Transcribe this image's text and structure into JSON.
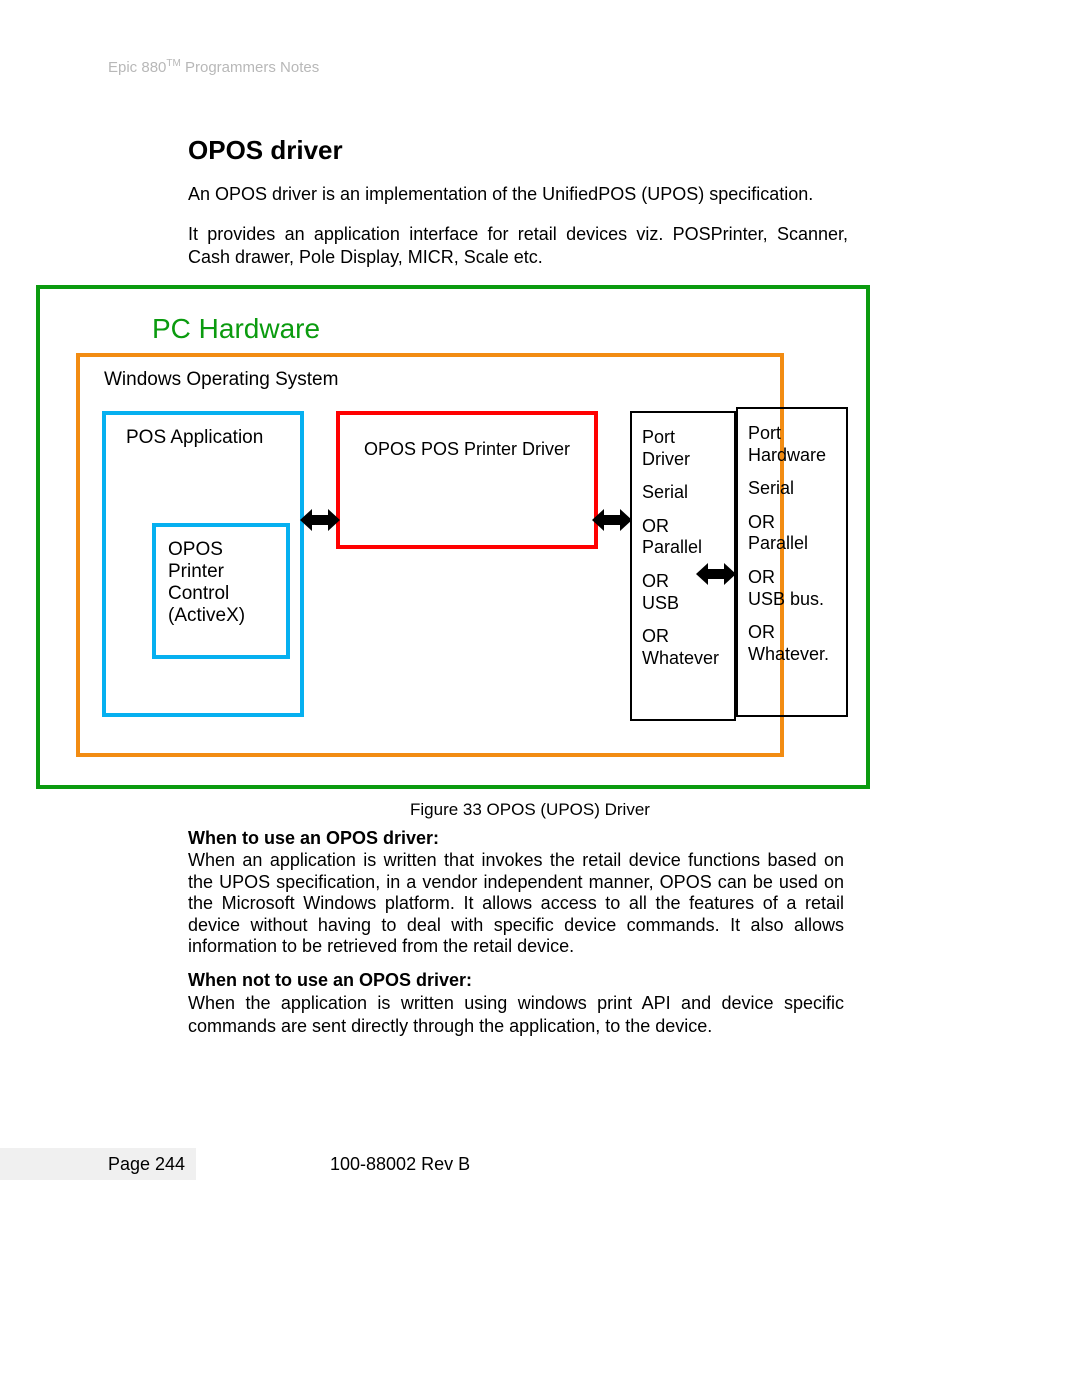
{
  "header": {
    "product": "Epic 880",
    "suffix": " Programmers Notes"
  },
  "title": "OPOS driver",
  "para1": "An OPOS driver is an implementation of the UnifiedPOS (UPOS) specification.",
  "para2": "It provides an application interface for retail devices viz. POSPrinter, Scanner, Cash drawer, Pole Display, MICR, Scale etc.",
  "diagram": {
    "pc_hw": "PC Hardware",
    "win_os": "Windows Operating System",
    "pos_app": "POS Application",
    "opos_ctrl_l1": "OPOS",
    "opos_ctrl_l2": "Printer",
    "opos_ctrl_l3": "Control",
    "opos_ctrl_l4": "(ActiveX)",
    "opos_driver": "OPOS POS Printer Driver",
    "pd_l1": "Port",
    "pd_l2": "Driver",
    "pd_l3": "Serial",
    "pd_l4": "OR",
    "pd_l5": "Parallel",
    "pd_l6": "OR",
    "pd_l7": "USB",
    "pd_l8": "OR",
    "pd_l9": "Whatever",
    "ph_l1": "Port",
    "ph_l2": "Hardware",
    "ph_l3": "Serial",
    "ph_l4": "OR",
    "ph_l5": "Parallel",
    "ph_l6": "OR",
    "ph_l7": "USB bus.",
    "ph_l8": "OR",
    "ph_l9": "Whatever."
  },
  "caption": "Figure 33 OPOS (UPOS) Driver",
  "when_use_title": "When to use an OPOS driver:",
  "when_use_para": "When an application is written that invokes the retail device functions based on the UPOS specification, in a vendor independent manner, OPOS can be used on the Microsoft Windows platform. It allows access to all the features of a retail device without having to deal with specific device commands. It also allows information to be retrieved from the retail device.",
  "when_not_title": "When not to use an OPOS driver:",
  "when_not_para": "When the application is written using windows print API and device specific commands are sent directly through the application, to the device.",
  "footer": {
    "page": "Page 244",
    "rev": "100-88002 Rev B"
  }
}
